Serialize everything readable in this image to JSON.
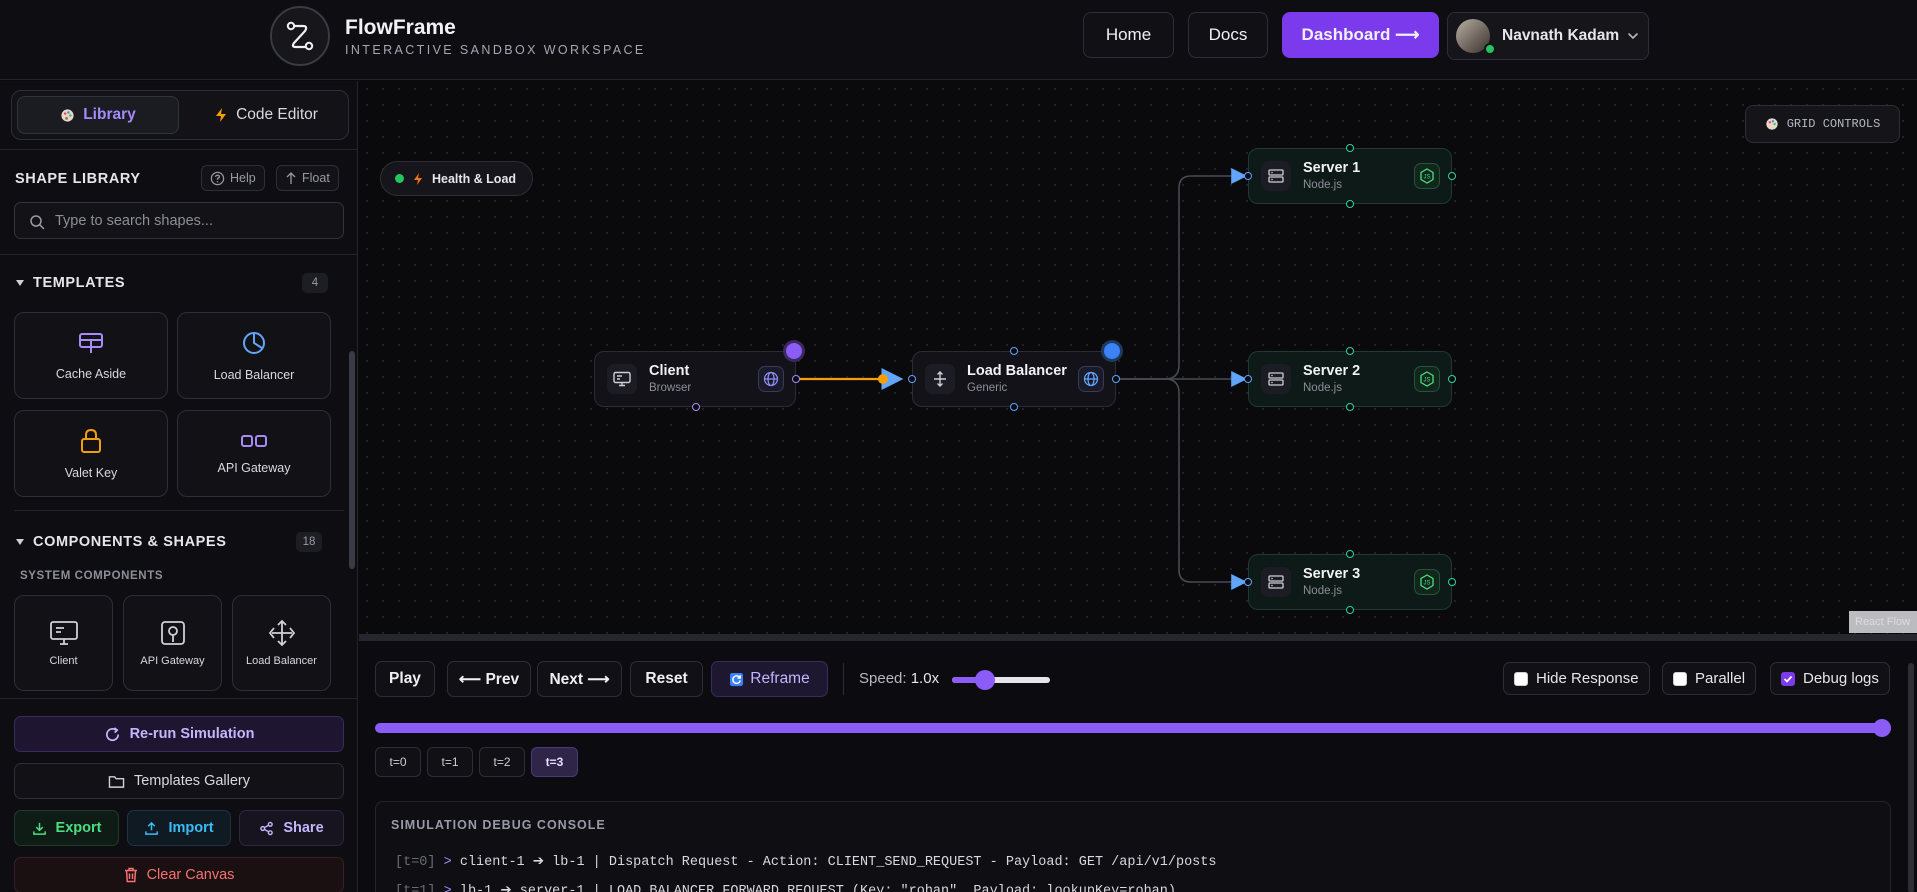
{
  "header": {
    "brand_title": "FlowFrame",
    "brand_subtitle": "INTERACTIVE SANDBOX WORKSPACE",
    "nav": {
      "home": "Home",
      "docs": "Docs",
      "dashboard": "Dashboard ⟶"
    },
    "user": {
      "name": "Navnath Kadam"
    }
  },
  "sidebar": {
    "tabs": {
      "library": "Library",
      "code_editor": "Code Editor"
    },
    "shape_library": {
      "title": "SHAPE LIBRARY",
      "help": "Help",
      "float": "Float",
      "search_placeholder": "Type to search shapes..."
    },
    "templates": {
      "title": "TEMPLATES",
      "count": "4",
      "items": [
        "Cache Aside",
        "Load Balancer",
        "Valet Key",
        "API Gateway"
      ]
    },
    "components": {
      "title": "COMPONENTS & SHAPES",
      "count": "18",
      "subcategory": "SYSTEM COMPONENTS",
      "items": [
        "Client",
        "API Gateway",
        "Load Balancer"
      ]
    },
    "actions": {
      "rerun": "Re-run Simulation",
      "gallery": "Templates Gallery",
      "export": "Export",
      "import": "Import",
      "share": "Share",
      "clear": "Clear Canvas"
    }
  },
  "canvas": {
    "grid_controls": "GRID CONTROLS",
    "health_badge": "Health & Load",
    "react_flow_tag": "React Flow",
    "nodes": {
      "client": {
        "title": "Client",
        "subtitle": "Browser"
      },
      "lb": {
        "title": "Load Balancer",
        "subtitle": "Generic"
      },
      "server1": {
        "title": "Server 1",
        "subtitle": "Node.js"
      },
      "server2": {
        "title": "Server 2",
        "subtitle": "Node.js"
      },
      "server3": {
        "title": "Server 3",
        "subtitle": "Node.js"
      }
    },
    "colors": {
      "accent": "#8b5cf6",
      "request_edge": "#f59e0b",
      "handle_blue": "#60a5fa",
      "handle_green": "#34d399"
    }
  },
  "simulation": {
    "controls": {
      "play": "Play",
      "prev": "⟵ Prev",
      "next": "Next ⟶",
      "reset": "Reset",
      "reframe": "Reframe"
    },
    "speed_label": "Speed:",
    "speed_value": "1.0x",
    "speed_fraction": 0.3,
    "options": {
      "hide_response": {
        "label": "Hide Response",
        "checked": false
      },
      "parallel": {
        "label": "Parallel",
        "checked": false
      },
      "debug_logs": {
        "label": "Debug logs",
        "checked": true
      }
    },
    "progress_fraction": 1.0,
    "steps": [
      "t=0",
      "t=1",
      "t=2",
      "t=3"
    ],
    "active_step": "t=3",
    "console": {
      "title": "SIMULATION DEBUG CONSOLE",
      "logs": [
        {
          "ts": "[t=0]",
          "text": "client-1 ➔ lb-1 | Dispatch Request - Action: CLIENT_SEND_REQUEST - Payload: GET /api/v1/posts"
        },
        {
          "ts": "[t=1]",
          "text": "lb-1 ➔ server-1 | LOAD_BALANCER_FORWARD_REQUEST (Key: \"rohan\", Payload: lookupKey=rohan)"
        }
      ]
    }
  }
}
